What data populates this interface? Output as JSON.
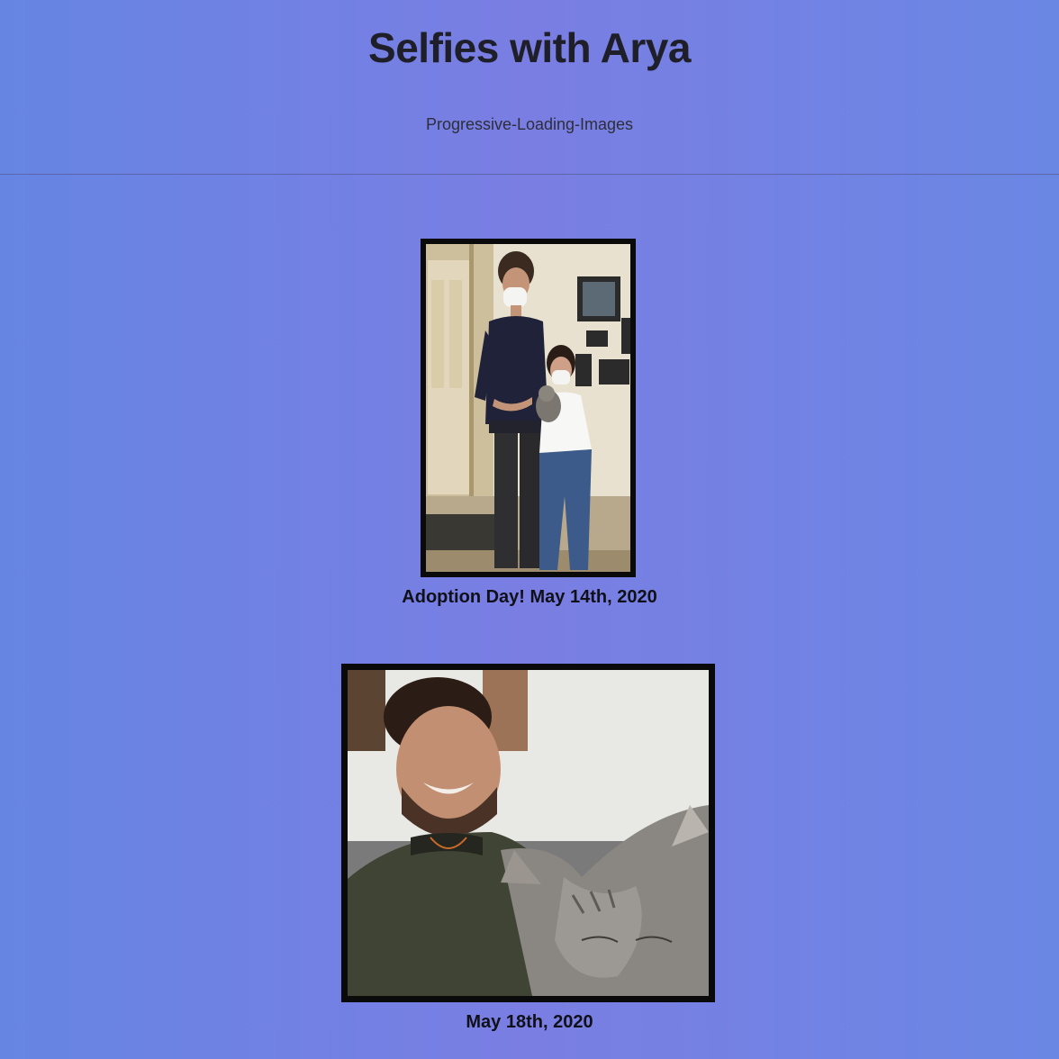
{
  "header": {
    "title": "Selfies with Arya",
    "subtitle": "Progressive-Loading-Images"
  },
  "gallery": [
    {
      "caption": "Adoption Day! May 14th, 2020",
      "image_desc": "Two people in face masks standing in a hallway, the woman holding a grey kitten"
    },
    {
      "caption": "May 18th, 2020",
      "image_desc": "Man taking a selfie with a sleeping grey tabby kitten"
    }
  ],
  "colors": {
    "background_start": "#6685e3",
    "background_mid": "#7a7ee3",
    "frame": "#0a0a0a",
    "title_text": "#1f1f2a"
  }
}
